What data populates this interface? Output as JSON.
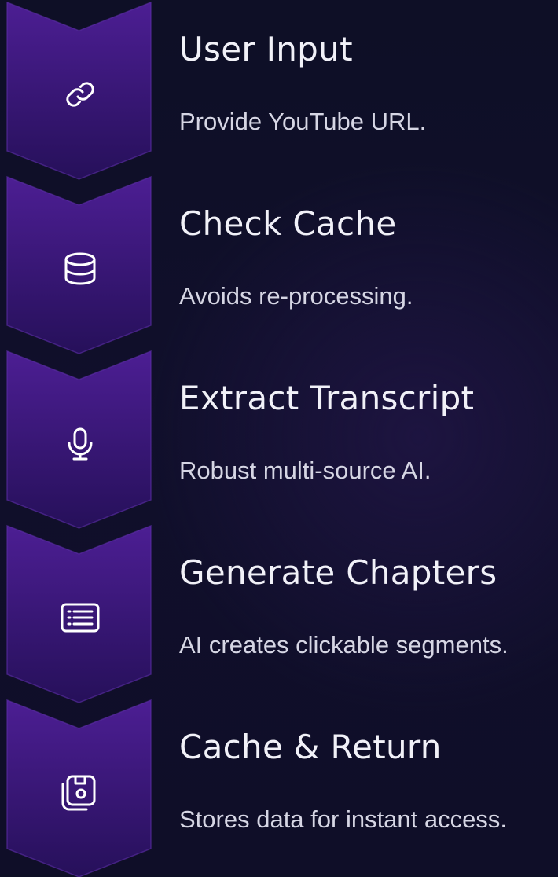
{
  "colors": {
    "chevron_top": "#4a1d8f",
    "chevron_bottom": "#2a1161",
    "chevron_edge": "#5e2fa8",
    "icon": "#ffffff",
    "title": "#f1f1f8",
    "description": "#d6d6e4"
  },
  "steps": [
    {
      "icon": "link-icon",
      "title": "User Input",
      "description": "Provide YouTube URL."
    },
    {
      "icon": "database-icon",
      "title": "Check Cache",
      "description": "Avoids re-processing."
    },
    {
      "icon": "microphone-icon",
      "title": "Extract Transcript",
      "description": "Robust multi-source AI."
    },
    {
      "icon": "list-icon",
      "title": "Generate Chapters",
      "description": "AI creates clickable segments."
    },
    {
      "icon": "save-icon",
      "title": "Cache & Return",
      "description": "Stores data for instant access."
    }
  ]
}
